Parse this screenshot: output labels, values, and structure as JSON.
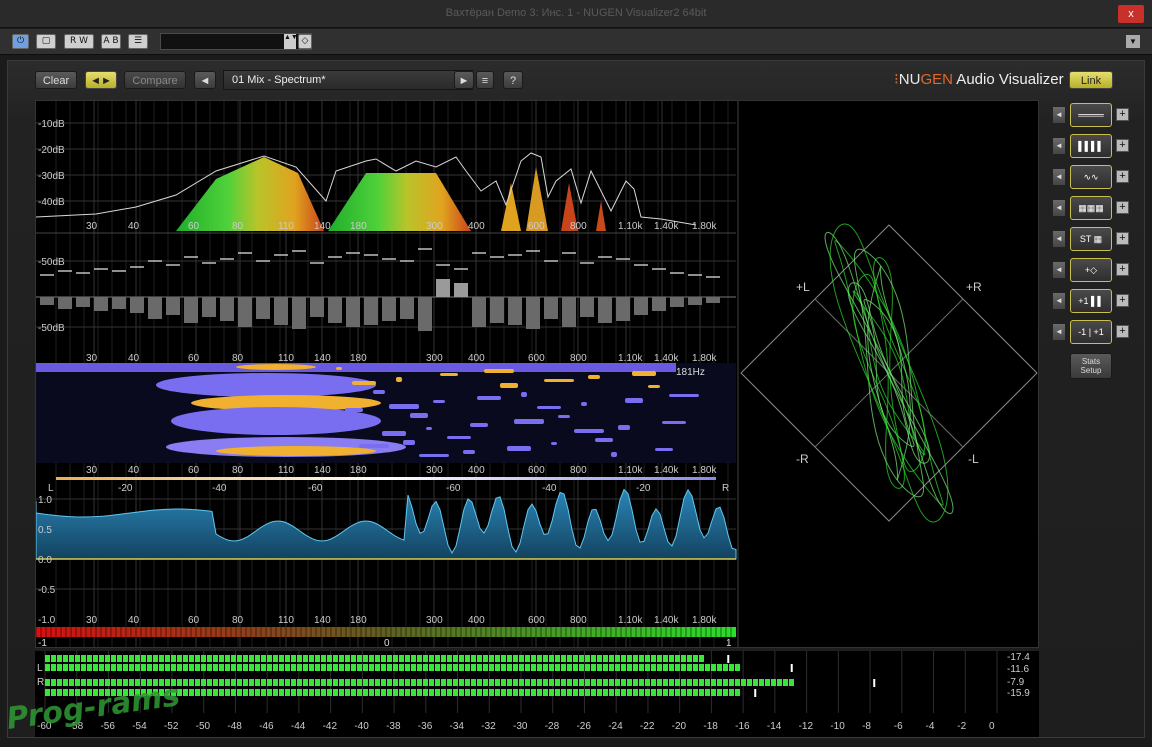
{
  "window": {
    "title": "Вахтёран Demo 3: Инс. 1 - NUGEN Visualizer2 64bit",
    "close": "x"
  },
  "host_toolbar": {
    "power": "⏻",
    "compare": "▢",
    "rw": "R W",
    "ab": "A B",
    "menu": "☰",
    "arrows": "▲▼",
    "options": "◇"
  },
  "plugin_toolbar": {
    "clear": "Clear",
    "swap": "◄►",
    "compare": "Compare",
    "prev": "◄",
    "view_name": "01 Mix - Spectrum*",
    "next": "►",
    "list": "≡",
    "help": "?",
    "brand_dots": "⁝",
    "brand_nu": "NU",
    "brand_gen": "GEN",
    "brand_rest": " Audio Visualizer",
    "link": "Link"
  },
  "freq_labels": [
    "30",
    "40",
    "60",
    "80",
    "110",
    "140",
    "180",
    "300",
    "400",
    "600",
    "800",
    "1.10k",
    "1.40k",
    "1.80k"
  ],
  "spectrum": {
    "db_labels": [
      "-10dB",
      "-20dB",
      "-30dB",
      "-40dB"
    ]
  },
  "difference": {
    "db_labels": [
      "-50dB",
      "-50dB"
    ]
  },
  "sonogram": {
    "readout": "181Hz"
  },
  "balance_scale": {
    "labels": [
      "L",
      "-20",
      "-40",
      "-60",
      "-60",
      "-40",
      "-20",
      "R"
    ]
  },
  "correlation": {
    "y_labels": [
      "1.0",
      "0.5",
      "0.0",
      "-0.5",
      "-1.0"
    ],
    "bar_labels": [
      "-1",
      "0",
      "1"
    ]
  },
  "vectorscope": {
    "labels": [
      "+L",
      "+R",
      "-R",
      "-L"
    ]
  },
  "right_panel": {
    "modes": [
      "════",
      "▌▌▌▌",
      "∿∿",
      "▦▦▦",
      "ST ▦",
      "+◇",
      "+1 ▌▌",
      "-1 | +1"
    ],
    "left": "◄",
    "plus": "+",
    "stats_line1": "Stats",
    "stats_line2": "Setup"
  },
  "meters": {
    "channel_L": "L",
    "channel_R": "R",
    "readouts": [
      "-17.4",
      "-11.6",
      "-7.9",
      "-15.9"
    ],
    "scale": [
      "-60",
      "-58",
      "-56",
      "-54",
      "-52",
      "-50",
      "-48",
      "-46",
      "-44",
      "-42",
      "-40",
      "-38",
      "-36",
      "-34",
      "-32",
      "-30",
      "-28",
      "-26",
      "-24",
      "-22",
      "-20",
      "-18",
      "-16",
      "-14",
      "-12",
      "-10",
      "-8",
      "-6",
      "-4",
      "-2",
      "0"
    ],
    "levels": {
      "L_rms": -18.5,
      "L_peak": -16.5,
      "R_peak": -12.8,
      "R_rms": -16.3
    }
  },
  "watermark": "Prog-rams",
  "colors": {
    "accent_yellow": "#d8d048",
    "brand_orange": "#e06828",
    "meter_green": "#39e539",
    "correlation_blue": "#1f6f9f"
  }
}
